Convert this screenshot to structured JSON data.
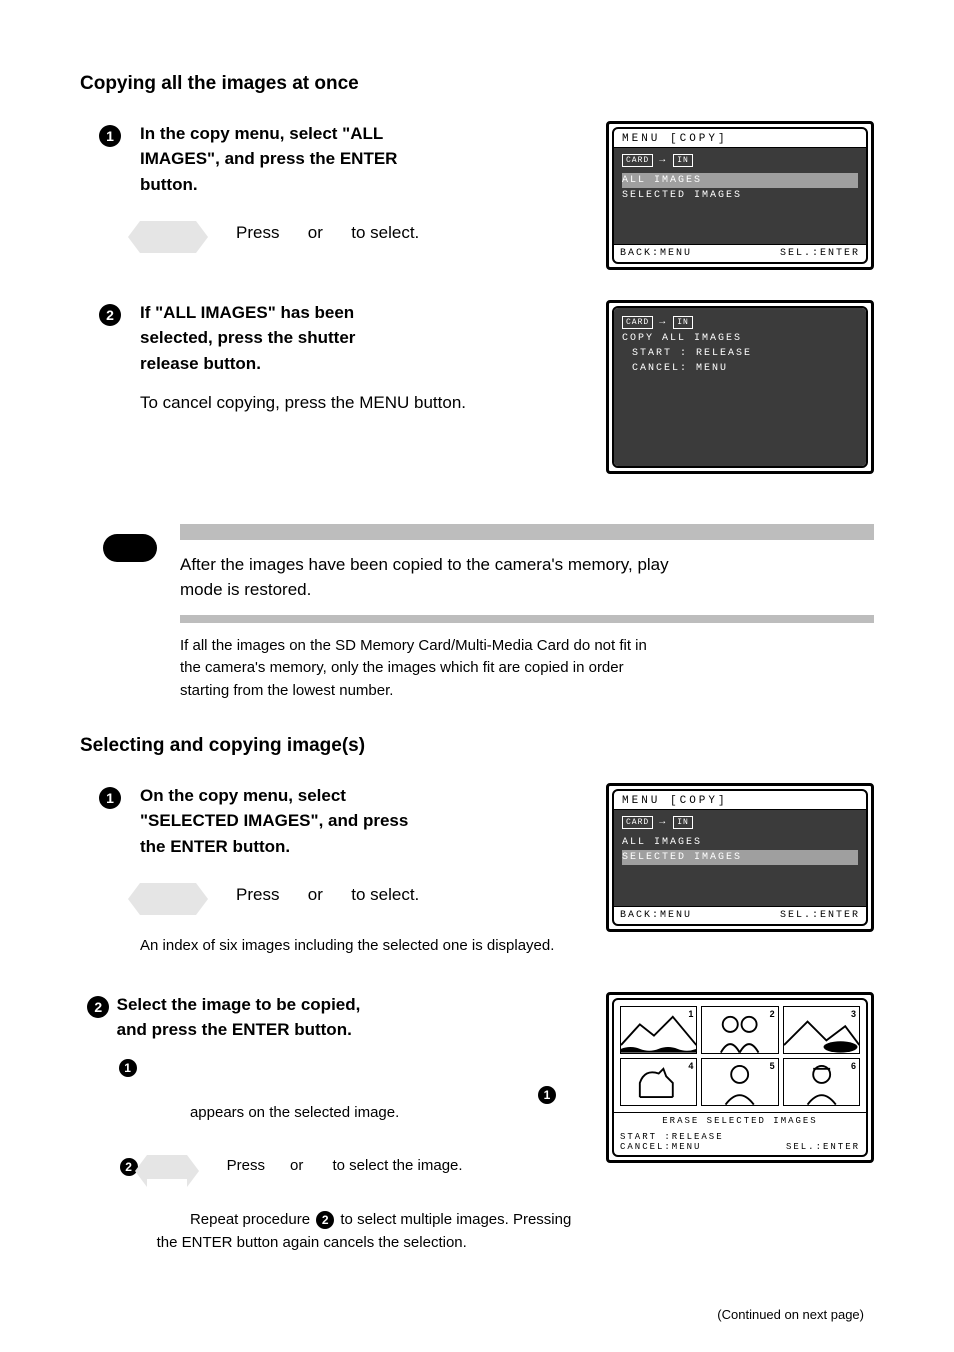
{
  "section1": {
    "heading": "Copying all the images at once",
    "step1": {
      "num": "1",
      "lines": [
        "In the copy menu, select \"ALL",
        "IMAGES\", and press the ENTER",
        "button."
      ],
      "hint": "Press      or      to select."
    },
    "step2": {
      "num": "2",
      "lines": [
        "If \"ALL IMAGES\" has been",
        "selected, press the shutter",
        "release button."
      ],
      "body_plain": "To cancel copying, press the MENU button."
    },
    "info1": {
      "lines": [
        "After the images have been copied to the camera's memory, play",
        "mode is restored."
      ]
    },
    "info2": {
      "lines": [
        "If all the images on the SD Memory Card/Multi-Media Card do not fit in",
        "the camera's memory, only the images which fit are copied in order",
        "starting from the lowest number."
      ]
    }
  },
  "section2": {
    "heading": "Selecting and copying image(s)",
    "step1": {
      "num": "1",
      "lines": [
        "On the copy menu, select",
        "\"SELECTED IMAGES\", and press",
        "the ENTER button."
      ],
      "hint": "Press      or      to select.",
      "body_plain": "An index of six images including the selected one is displayed."
    },
    "step2": {
      "num": "2",
      "lines": [
        "Select the image to be copied,",
        "and press the ENTER button."
      ],
      "sub1": "appears on the selected image.",
      "sub2_a": "Press      or       to select the image.",
      "sub2_b": "Repeat procedure      to select multiple images. Pressing the ENTER button again cancels the selection.",
      "sub2_b_ref": "2"
    }
  },
  "screens": {
    "menu1": {
      "title": "MENU [COPY]",
      "src": "CARD",
      "dst": "IN",
      "opt1": "ALL IMAGES",
      "opt2": "SELECTED IMAGES",
      "back": "BACK:MENU",
      "sel": "SEL.:ENTER"
    },
    "confirm": {
      "src": "CARD",
      "dst": "IN",
      "l1": "COPY ALL IMAGES",
      "l2": "START : RELEASE",
      "l3": "CANCEL: MENU"
    },
    "menu2": {
      "title": "MENU [COPY]",
      "src": "CARD",
      "dst": "IN",
      "opt1": "ALL IMAGES",
      "opt2": "SELECTED IMAGES",
      "back": "BACK:MENU",
      "sel": "SEL.:ENTER"
    },
    "thumbs": {
      "caption": "ERASE SELECTED IMAGES",
      "start": "START :RELEASE",
      "cancel": "CANCEL:MENU",
      "sel": "SEL.:ENTER",
      "nums": [
        "1",
        "2",
        "3",
        "4",
        "5",
        "6"
      ],
      "ref_badge": "1"
    }
  },
  "footer": "(Continued on next page)"
}
